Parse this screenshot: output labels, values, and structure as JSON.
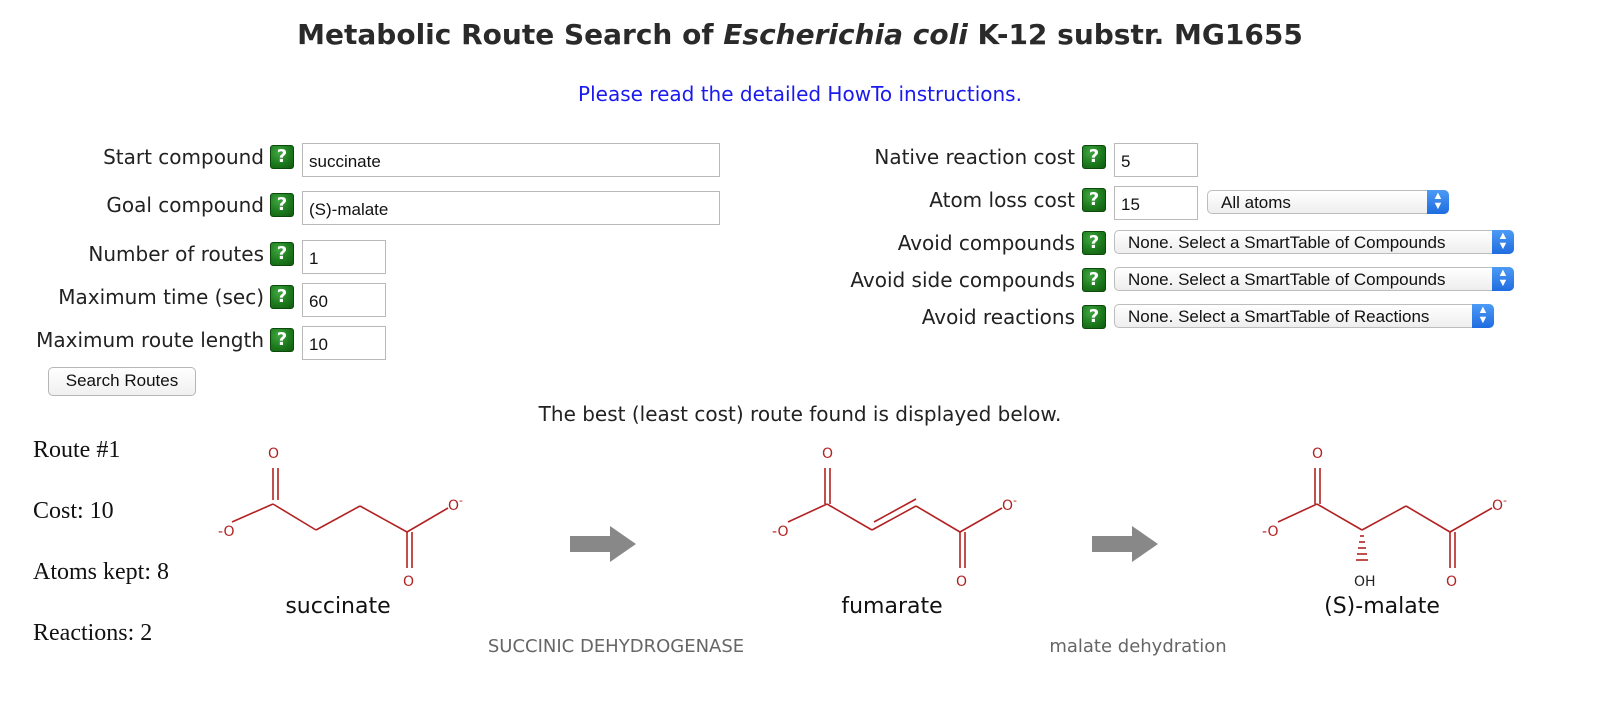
{
  "header": {
    "title_prefix": "Metabolic Route Search of ",
    "title_organism": "Escherichia coli",
    "title_suffix": " K-12 substr. MG1655",
    "howto_link": "Please read the detailed HowTo instructions."
  },
  "form_left": {
    "start_compound": {
      "label": "Start compound",
      "value": "succinate"
    },
    "goal_compound": {
      "label": "Goal compound",
      "value": "(S)-malate"
    },
    "num_routes": {
      "label": "Number of routes",
      "value": "1"
    },
    "max_time": {
      "label": "Maximum time (sec)",
      "value": "60"
    },
    "max_length": {
      "label": "Maximum route length",
      "value": "10"
    },
    "search_button": "Search Routes"
  },
  "form_right": {
    "native_cost": {
      "label": "Native reaction cost",
      "value": "5"
    },
    "atom_loss": {
      "label": "Atom loss cost",
      "value": "15",
      "select": "All atoms"
    },
    "avoid_compounds": {
      "label": "Avoid compounds",
      "select": "None. Select a SmartTable of Compounds"
    },
    "avoid_side": {
      "label": "Avoid side compounds",
      "select": "None. Select a SmartTable of Compounds"
    },
    "avoid_reactions": {
      "label": "Avoid reactions",
      "select": "None. Select a SmartTable of Reactions"
    }
  },
  "result": {
    "intro": "The best (least cost) route found is displayed below.",
    "route": "Route #1",
    "cost": "Cost: 10",
    "atoms_kept": "Atoms kept: 8",
    "reactions": "Reactions: 2",
    "compounds": [
      "succinate",
      "fumarate",
      "(S)-malate"
    ],
    "reaction_names": [
      "SUCCINIC DEHYDROGENASE",
      "malate dehydration"
    ],
    "atom_labels": {
      "o": "O",
      "o_minus": "O",
      "minus": "-",
      "oh": "OH"
    }
  },
  "colors": {
    "link": "#1a1aee",
    "structure": "#b22222",
    "help_icon": "#1d7a1d",
    "arrow": "#888888",
    "select_arrow": "#1f6ce0"
  },
  "icons": {
    "help": "?",
    "select_updown": "⌃⌄"
  }
}
